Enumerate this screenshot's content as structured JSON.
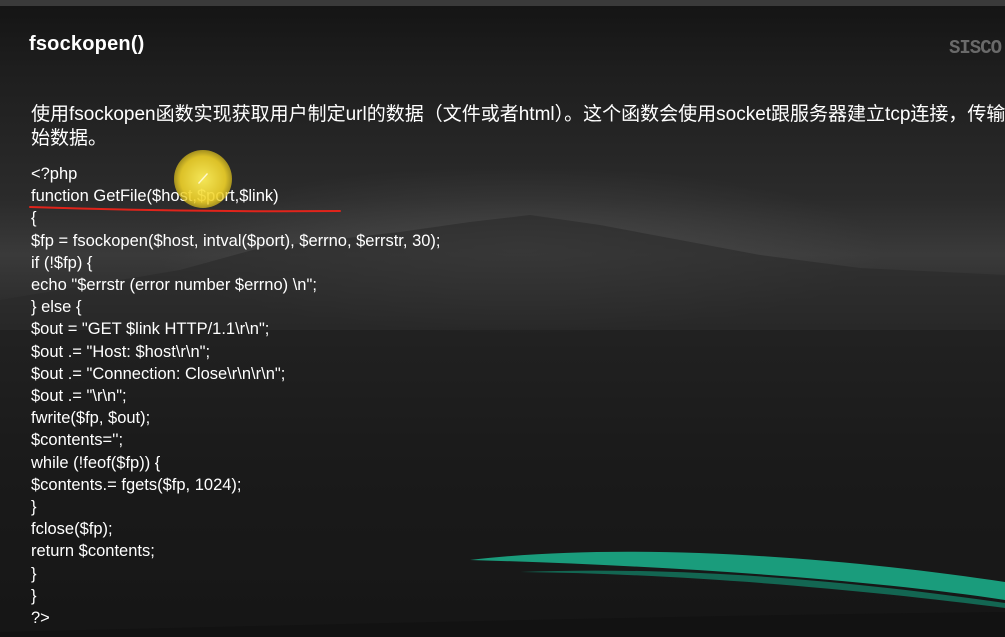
{
  "slide": {
    "title": "fsockopen()",
    "logo": "SISCO",
    "intro": "使用fsockopen函数实现获取用户制定url的数据（文件或者html）。这个函数会使用socket跟服务器建立tcp连接，传输原始数据。",
    "code_lines": [
      "<?php",
      "function GetFile($host,$port,$link)",
      "{",
      "$fp = fsockopen($host, intval($port), $errno, $errstr, 30);",
      "if (!$fp) {",
      "echo \"$errstr (error number $errno) \\n\";",
      "} else {",
      "$out = \"GET $link HTTP/1.1\\r\\n\";",
      "$out .= \"Host: $host\\r\\n\";",
      "$out .= \"Connection: Close\\r\\n\\r\\n\";",
      "$out .= \"\\r\\n\";",
      "fwrite($fp, $out);",
      "$contents='';",
      "while (!feof($fp)) {",
      "$contents.= fgets($fp, 1024);",
      "}",
      "fclose($fp);",
      "return $contents;",
      "}",
      "}",
      "?>"
    ]
  },
  "colors": {
    "text": "#ffffff",
    "annotation_underline": "#e0241b",
    "pointer_highlight": "#f5e23a",
    "accent_swoosh": "#1a9c7c"
  },
  "icons": {
    "pointer": "mouse-pointer-highlight"
  }
}
